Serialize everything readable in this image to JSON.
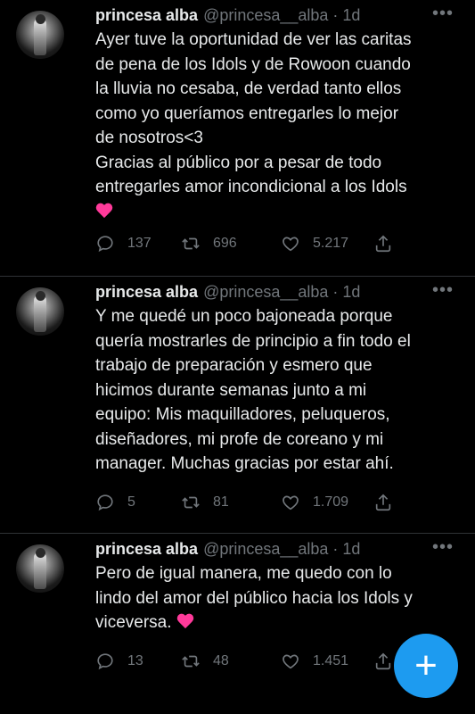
{
  "tweets": [
    {
      "name": "princesa alba",
      "handle": "@princesa__alba · 1d",
      "text": "Ayer tuve la oportunidad de ver las caritas\nde pena de los Idols y de Rowoon cuando\nla lluvia no cesaba, de verdad tanto ellos\ncomo yo queríamos entregarles lo mejor\nde nosotros<3\nGracias al público por a pesar de todo\nentregarles amor incondicional a los Idols",
      "emoji": "sparkling-heart",
      "replies": "137",
      "retweets": "696",
      "likes": "5.217"
    },
    {
      "name": "princesa alba",
      "handle": "@princesa__alba · 1d",
      "text": "Y me quedé un poco bajoneada porque\nquería mostrarles de principio a fin todo el\ntrabajo de preparación y esmero que\nhicimos durante semanas junto a mi\nequipo: Mis maquilladores, peluqueros,\ndiseñadores, mi profe de coreano y mi\nmanager. Muchas gracias por estar ahí.",
      "replies": "5",
      "retweets": "81",
      "likes": "1.709"
    },
    {
      "name": "princesa alba",
      "handle": "@princesa__alba · 1d",
      "text": "Pero de igual manera, me quedo con lo\nlindo del amor del público hacia los Idols y\nviceversa. ",
      "emoji": "sparkling-heart",
      "replies": "13",
      "retweets": "48",
      "likes": "1.451"
    }
  ],
  "more_label": "•••",
  "fab": {
    "label": "+",
    "icon": "compose-plus-icon",
    "color": "#1d9bf0"
  },
  "colors": {
    "background": "#000000",
    "text": "#e7e9ea",
    "muted": "#71767b",
    "emoji": "#ff3a9a"
  }
}
